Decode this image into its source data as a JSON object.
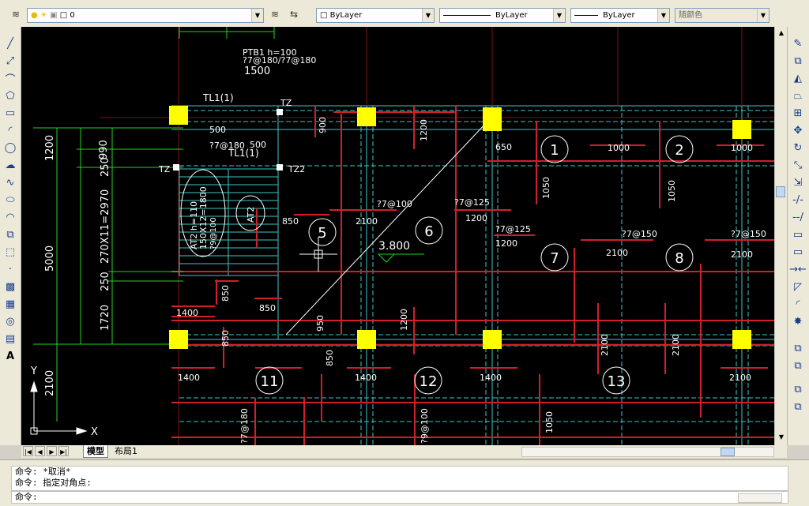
{
  "layer": {
    "current_name": "0"
  },
  "properties": {
    "color": "ByLayer",
    "linetype": "ByLayer",
    "lineweight": "ByLayer",
    "plotstyle": "随颜色"
  },
  "tabs": [
    "模型",
    "布局1"
  ],
  "command": {
    "lines": [
      "命令:  *取消*",
      "命令:  指定对角点:"
    ],
    "prompt": "命令:"
  },
  "ucs": {
    "x": "X",
    "y": "Y"
  },
  "drawing": {
    "panel_numbers": [
      "1",
      "2",
      "5",
      "6",
      "7",
      "8",
      "11",
      "12",
      "13"
    ],
    "elevation": "3.800",
    "tb_labels": [
      "PTB1 h=100",
      "?7@180/?7@180",
      "1500",
      "TL1(1)",
      "TZ",
      "TZ2",
      "TL1(1)"
    ],
    "stair_labels": [
      "AT2 h=110",
      "150X12=1800",
      "?9@100",
      "AT2"
    ],
    "dims_left": [
      "1200",
      "990",
      "250",
      "270X11=2970",
      "5000",
      "250",
      "1720",
      "2100"
    ],
    "rebar_labels": [
      "900",
      "1200",
      "650",
      "1000",
      "1000",
      "1050",
      "1050",
      "850",
      "2100",
      "?7@100",
      "?7@125",
      "1200",
      "?7@125",
      "1200",
      "?7@150",
      "2100",
      "2100",
      "?7@150",
      "850",
      "850",
      "1400",
      "850",
      "950",
      "1200",
      "850",
      "1400",
      "1400",
      "1400",
      "2100",
      "2100",
      "2100",
      "1050",
      "?9@100",
      "?7@180",
      "500",
      "?7@180",
      "500"
    ]
  },
  "colors": {
    "background": "#000000",
    "column": "#ffff00",
    "rebar": "#d0202a",
    "dashed_beam": "#3fc6c6",
    "dimension": "#22d422",
    "text": "#ffffff"
  }
}
